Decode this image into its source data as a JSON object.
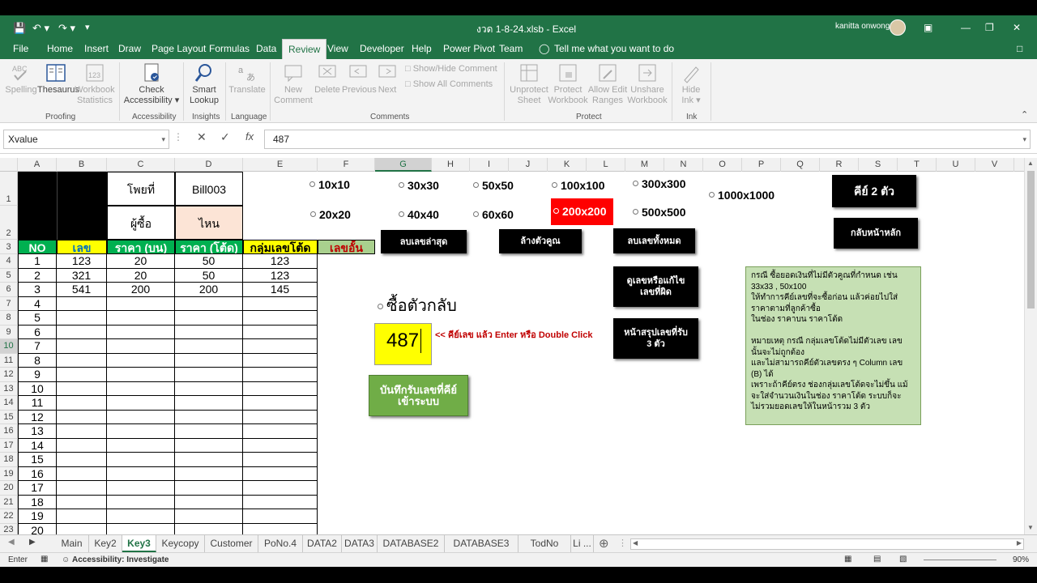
{
  "window": {
    "title": "งวด 1-8-24.xlsb  -  Excel",
    "user": "kanitta onwong"
  },
  "tabs": [
    "File",
    "Home",
    "Insert",
    "Draw",
    "Page Layout",
    "Formulas",
    "Data",
    "Review",
    "View",
    "Developer",
    "Help",
    "Power Pivot",
    "Team"
  ],
  "tell_me": "Tell me what you want to do",
  "ribbon": {
    "spelling": "Spelling",
    "thesaurus": "Thesaurus",
    "workbook_stats": [
      "Workbook",
      "Statistics"
    ],
    "proofing": "Proofing",
    "check_accessibility": [
      "Check",
      "Accessibility ▾"
    ],
    "accessibility": "Accessibility",
    "smart_lookup": [
      "Smart",
      "Lookup"
    ],
    "insights": "Insights",
    "translate": "Translate",
    "language": "Language",
    "new_comment": [
      "New",
      "Comment"
    ],
    "delete": "Delete",
    "previous": "Previous",
    "next": "Next",
    "show_hide_comment": "Show/Hide Comment",
    "show_all_comments": "Show All Comments",
    "comments": "Comments",
    "unprotect_sheet": [
      "Unprotect",
      "Sheet"
    ],
    "protect_workbook": [
      "Protect",
      "Workbook"
    ],
    "allow_edit_ranges": [
      "Allow Edit",
      "Ranges"
    ],
    "unshare_workbook": [
      "Unshare",
      "Workbook"
    ],
    "protect": "Protect",
    "hide_ink": [
      "Hide",
      "Ink ▾"
    ],
    "ink": "Ink"
  },
  "formula_bar": {
    "name_box": "Xvalue",
    "formula": "487"
  },
  "columns": [
    "A",
    "B",
    "C",
    "D",
    "E",
    "F",
    "G",
    "H",
    "I",
    "J",
    "K",
    "L",
    "M",
    "N",
    "O",
    "P",
    "Q",
    "R",
    "S",
    "T",
    "U",
    "V"
  ],
  "rows": [
    "1",
    "2",
    "3",
    "4",
    "5",
    "6",
    "7",
    "8",
    "9",
    "10",
    "11",
    "12",
    "13",
    "14",
    "15",
    "16",
    "17",
    "18",
    "19",
    "20",
    "21",
    "22",
    "23"
  ],
  "header_cells": {
    "c1": "โพยที่",
    "d1": "Bill003",
    "c2": "ผู้ซื้อ",
    "d2": "ไหน"
  },
  "table_headers": [
    "NO",
    "เลข",
    "ราคา (บน)",
    "ราคา (โต้ด)",
    "กลุ่มเลขโต้ด",
    "เลขอั้น"
  ],
  "table_rows": [
    [
      "1",
      "123",
      "20",
      "50",
      "123"
    ],
    [
      "2",
      "321",
      "20",
      "50",
      "123"
    ],
    [
      "3",
      "541",
      "200",
      "200",
      "145"
    ],
    [
      "4",
      "",
      "",
      "",
      ""
    ],
    [
      "5",
      "",
      "",
      "",
      ""
    ],
    [
      "6",
      "",
      "",
      "",
      ""
    ],
    [
      "7",
      "",
      "",
      "",
      ""
    ],
    [
      "8",
      "",
      "",
      "",
      ""
    ],
    [
      "9",
      "",
      "",
      "",
      ""
    ],
    [
      "10",
      "",
      "",
      "",
      ""
    ],
    [
      "11",
      "",
      "",
      "",
      ""
    ],
    [
      "12",
      "",
      "",
      "",
      ""
    ],
    [
      "13",
      "",
      "",
      "",
      ""
    ],
    [
      "14",
      "",
      "",
      "",
      ""
    ],
    [
      "15",
      "",
      "",
      "",
      ""
    ],
    [
      "16",
      "",
      "",
      "",
      ""
    ],
    [
      "17",
      "",
      "",
      "",
      ""
    ],
    [
      "18",
      "",
      "",
      "",
      ""
    ],
    [
      "19",
      "",
      "",
      "",
      ""
    ],
    [
      "20",
      "",
      "",
      "",
      ""
    ]
  ],
  "grid_options": {
    "row1": [
      "10x10",
      "30x30",
      "50x50",
      "100x100",
      "300x300"
    ],
    "row2": [
      "20x20",
      "40x40",
      "60x60",
      "200x200",
      "500x500"
    ],
    "extra": "1000x1000",
    "selected": "200x200"
  },
  "buttons": {
    "key2": "คีย์ 2 ตัว",
    "home": "กลับหน้าหลัก",
    "delete_last": "ลบเลขล่าสุด",
    "clear_multiplier": "ล้างตัวคูณ",
    "delete_all": "ลบเลขทั้งหมด",
    "view_edit": "ดูเลขหรือแก้ไข เลขที่ผิด",
    "summary": "หน้าสรุปเลขที่รับ 3 ตัว",
    "save": "บันทึกรับเลขที่คีย์ เข้าระบบ"
  },
  "buy_reverse": "ซื้อตัวกลับ",
  "input_value": "487",
  "hint": "<< คีย์เลข แล้ว Enter หรือ Double Click",
  "note_lines": [
    "กรณี ซื้อยอดเงินที่ไม่มีตัวคูณที่กำหนด เช่น",
    "33x33 , 50x100",
    "ให้ทำการคีย์เลขที่จะซื้อก่อน แล้วค่อยไปใส่",
    "ราคาตามที่ลูกค้าซื้อ",
    "ในช่อง ราคาบน ราคาโต้ด",
    "",
    "หมายเหตุ  กรณี กลุ่มเลขโต้ดไม่มีตัวเลข เลข",
    "นั้นจะไม่ถูกต้อง",
    "และไม่สามารถคีย์ตัวเลขตรง ๆ Column เลข",
    "(B) ได้",
    "เพราะถ้าคีย์ตรง ช่องกลุ่มเลขโต้ดจะไม่ขึ้น แม้",
    "จะใส่จำนวนเงินในช่อง ราคาโต้ด   ระบบก็จะ",
    "ไม่รวมยอดเลขให้ในหน้ารวม 3 ตัว"
  ],
  "sheet_tabs": [
    "Main",
    "Key2",
    "Key3",
    "Keycopy",
    "Customer",
    "PoNo.4",
    "DATA2",
    "DATA3",
    "DATABASE2",
    "DATABASE3",
    "TodNo",
    "Li ..."
  ],
  "active_sheet": "Key3",
  "status": {
    "mode": "Enter",
    "accessibility": "Accessibility: Investigate",
    "zoom": "90%"
  },
  "colors": {
    "excel_green": "#217346",
    "header_green": "#00b050",
    "header_yellow": "#ffff00",
    "peach": "#fce4d6",
    "note_green": "#c6e0b4",
    "red_select": "#ff0000"
  }
}
